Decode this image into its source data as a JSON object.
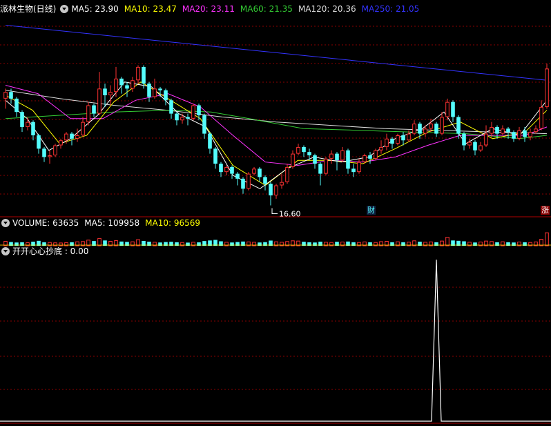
{
  "stock": {
    "name": "派林生物(日线)",
    "ma": [
      {
        "label": "MA5: 23.90",
        "color": "#ffffff"
      },
      {
        "label": "MA10: 23.47",
        "color": "#ffff00"
      },
      {
        "label": "MA20: 23.11",
        "color": "#ff33ff"
      },
      {
        "label": "MA60: 21.35",
        "color": "#33cc33"
      },
      {
        "label": "MA120: 20.36",
        "color": "#dddddd"
      },
      {
        "label": "MA250: 21.05",
        "color": "#3333ff"
      }
    ],
    "low_label": "16.60",
    "badge_cai": "财",
    "badge_zhang": "涨"
  },
  "volume": {
    "label": "VOLUME: 63635",
    "ma5": "MA5: 109958",
    "ma10": "MA10: 96569"
  },
  "indicator": {
    "label": "开开心心抄底 : 0.00"
  },
  "colors": {
    "up": "#ff3232",
    "down": "#54fcfc",
    "grid": "#8b0000",
    "ma5": "#ffffff",
    "ma10": "#ffff00",
    "ma20": "#ff33ff",
    "ma60": "#33cc33",
    "ma120": "#dddddd",
    "ma250": "#3333ff"
  },
  "chart_data": {
    "type": "candlestick",
    "price_range": [
      16.0,
      28.0
    ],
    "candles": [
      [
        23.0,
        23.4,
        22.4,
        23.6
      ],
      [
        23.4,
        23.0,
        22.7,
        23.6
      ],
      [
        23.0,
        22.2,
        21.9,
        23.1
      ],
      [
        22.2,
        21.3,
        21.0,
        22.3
      ],
      [
        21.3,
        21.6,
        21.1,
        21.9
      ],
      [
        21.6,
        20.8,
        20.5,
        21.7
      ],
      [
        20.8,
        20.0,
        19.7,
        20.9
      ],
      [
        20.0,
        19.5,
        19.2,
        20.1
      ],
      [
        19.5,
        19.6,
        19.1,
        19.9
      ],
      [
        19.6,
        20.2,
        19.5,
        20.3
      ],
      [
        20.2,
        20.5,
        20.0,
        20.6
      ],
      [
        20.5,
        20.9,
        20.3,
        21.0
      ],
      [
        20.9,
        20.6,
        20.2,
        21.0
      ],
      [
        20.6,
        20.8,
        20.4,
        21.2
      ],
      [
        20.8,
        21.6,
        20.7,
        21.9
      ],
      [
        21.6,
        22.6,
        21.4,
        22.8
      ],
      [
        22.6,
        22.1,
        21.9,
        22.7
      ],
      [
        22.1,
        23.6,
        22.0,
        24.6
      ],
      [
        23.6,
        23.2,
        22.5,
        23.9
      ],
      [
        23.2,
        23.4,
        22.6,
        23.8
      ],
      [
        23.4,
        24.2,
        23.1,
        24.9
      ],
      [
        24.2,
        23.8,
        23.3,
        24.3
      ],
      [
        23.8,
        23.6,
        23.1,
        24.0
      ],
      [
        23.6,
        24.1,
        23.4,
        24.3
      ],
      [
        24.1,
        24.9,
        23.9,
        25.0
      ],
      [
        24.9,
        23.9,
        23.6,
        25.0
      ],
      [
        23.9,
        23.1,
        22.8,
        24.0
      ],
      [
        23.1,
        23.6,
        23.0,
        24.2
      ],
      [
        23.6,
        23.5,
        23.1,
        23.7
      ],
      [
        23.5,
        22.9,
        22.6,
        23.6
      ],
      [
        22.9,
        22.1,
        21.8,
        23.0
      ],
      [
        22.1,
        21.7,
        21.4,
        22.2
      ],
      [
        21.7,
        21.9,
        21.5,
        22.1
      ],
      [
        21.9,
        21.8,
        21.4,
        22.1
      ],
      [
        21.8,
        22.6,
        21.7,
        22.7
      ],
      [
        22.6,
        22.0,
        21.7,
        22.7
      ],
      [
        22.0,
        20.9,
        20.6,
        22.1
      ],
      [
        20.9,
        20.0,
        19.7,
        21.0
      ],
      [
        20.0,
        19.1,
        18.8,
        20.1
      ],
      [
        19.1,
        18.6,
        18.3,
        19.2
      ],
      [
        18.6,
        18.9,
        18.4,
        19.0
      ],
      [
        18.9,
        18.5,
        18.2,
        19.0
      ],
      [
        18.5,
        18.2,
        17.8,
        18.6
      ],
      [
        18.2,
        17.6,
        17.3,
        18.3
      ],
      [
        17.6,
        18.5,
        17.5,
        18.6
      ],
      [
        18.5,
        18.8,
        18.4,
        18.9
      ],
      [
        18.8,
        18.3,
        18.0,
        18.9
      ],
      [
        18.3,
        17.9,
        17.5,
        18.4
      ],
      [
        17.9,
        17.2,
        16.6,
        18.0
      ],
      [
        17.2,
        17.8,
        17.0,
        17.9
      ],
      [
        17.8,
        18.0,
        17.6,
        18.5
      ],
      [
        18.0,
        18.9,
        17.9,
        19.1
      ],
      [
        18.9,
        19.7,
        18.8,
        19.9
      ],
      [
        19.7,
        20.1,
        19.6,
        20.3
      ],
      [
        20.1,
        19.8,
        19.5,
        20.2
      ],
      [
        19.8,
        19.6,
        19.3,
        20.0
      ],
      [
        19.6,
        19.1,
        18.8,
        19.7
      ],
      [
        19.1,
        18.5,
        17.8,
        19.2
      ],
      [
        18.5,
        19.4,
        18.4,
        19.5
      ],
      [
        19.4,
        19.7,
        19.1,
        19.9
      ],
      [
        19.7,
        19.3,
        18.7,
        19.8
      ],
      [
        19.3,
        19.9,
        19.2,
        20.1
      ],
      [
        19.9,
        18.8,
        18.5,
        20.0
      ],
      [
        18.8,
        18.6,
        18.3,
        19.1
      ],
      [
        18.6,
        19.2,
        18.5,
        19.4
      ],
      [
        19.2,
        19.6,
        19.1,
        19.7
      ],
      [
        19.6,
        19.4,
        19.1,
        19.8
      ],
      [
        19.4,
        19.9,
        19.3,
        20.0
      ],
      [
        19.9,
        20.1,
        19.7,
        20.5
      ],
      [
        20.1,
        20.6,
        19.9,
        20.9
      ],
      [
        20.6,
        20.3,
        20.0,
        20.7
      ],
      [
        20.3,
        20.8,
        20.2,
        20.9
      ],
      [
        20.8,
        20.5,
        20.2,
        21.0
      ],
      [
        20.5,
        20.9,
        20.4,
        21.1
      ],
      [
        20.9,
        21.5,
        20.8,
        21.7
      ],
      [
        21.5,
        20.9,
        20.6,
        21.6
      ],
      [
        20.9,
        21.2,
        20.7,
        21.4
      ],
      [
        21.2,
        21.5,
        21.0,
        21.8
      ],
      [
        21.5,
        20.9,
        20.7,
        21.6
      ],
      [
        20.9,
        21.9,
        20.8,
        22.2
      ],
      [
        21.9,
        22.8,
        21.7,
        23.0
      ],
      [
        22.8,
        21.9,
        21.6,
        22.9
      ],
      [
        21.9,
        20.9,
        20.6,
        22.0
      ],
      [
        20.9,
        20.2,
        19.9,
        21.0
      ],
      [
        20.2,
        20.4,
        20.0,
        20.6
      ],
      [
        20.4,
        19.9,
        19.6,
        20.5
      ],
      [
        19.9,
        20.2,
        19.8,
        20.4
      ],
      [
        20.2,
        20.9,
        20.1,
        21.4
      ],
      [
        20.9,
        21.3,
        20.7,
        21.6
      ],
      [
        21.3,
        20.9,
        20.6,
        21.4
      ],
      [
        20.9,
        21.2,
        20.8,
        21.4
      ],
      [
        21.2,
        21.0,
        20.6,
        21.3
      ],
      [
        21.0,
        20.6,
        20.4,
        21.1
      ],
      [
        20.6,
        21.1,
        20.5,
        21.3
      ],
      [
        21.1,
        20.7,
        20.4,
        21.3
      ],
      [
        20.7,
        21.0,
        20.5,
        21.2
      ],
      [
        21.0,
        21.2,
        20.9,
        21.4
      ],
      [
        21.2,
        22.5,
        21.1,
        22.9
      ],
      [
        22.5,
        24.8,
        22.4,
        25.1
      ]
    ],
    "low_marker_index": 48,
    "ma_series": {
      "ma250": [
        [
          0,
          27.4
        ],
        [
          100,
          24.1
        ]
      ],
      "ma120": [
        [
          0,
          23.5
        ],
        [
          10,
          23.0
        ],
        [
          20,
          22.6
        ],
        [
          30,
          22.3
        ],
        [
          40,
          21.9
        ],
        [
          50,
          21.6
        ],
        [
          60,
          21.4
        ],
        [
          70,
          21.2
        ],
        [
          80,
          21.1
        ],
        [
          90,
          21.0
        ],
        [
          100,
          20.9
        ]
      ],
      "ma60": [
        [
          0,
          21.8
        ],
        [
          10,
          22.0
        ],
        [
          20,
          22.2
        ],
        [
          30,
          22.3
        ],
        [
          38,
          22.2
        ],
        [
          45,
          21.8
        ],
        [
          55,
          21.2
        ],
        [
          65,
          21.1
        ],
        [
          75,
          21.0
        ],
        [
          85,
          20.9
        ],
        [
          95,
          20.6
        ],
        [
          100,
          20.8
        ]
      ],
      "ma20": [
        [
          0,
          23.8
        ],
        [
          6,
          23.3
        ],
        [
          12,
          21.8
        ],
        [
          18,
          21.8
        ],
        [
          24,
          22.9
        ],
        [
          30,
          23.3
        ],
        [
          36,
          22.5
        ],
        [
          42,
          20.8
        ],
        [
          48,
          19.2
        ],
        [
          54,
          19.0
        ],
        [
          60,
          19.3
        ],
        [
          66,
          19.2
        ],
        [
          72,
          19.5
        ],
        [
          78,
          20.2
        ],
        [
          84,
          20.8
        ],
        [
          90,
          20.8
        ],
        [
          96,
          20.8
        ],
        [
          100,
          21.3
        ]
      ],
      "ma10": [
        [
          0,
          23.2
        ],
        [
          5,
          22.3
        ],
        [
          10,
          20.3
        ],
        [
          15,
          20.8
        ],
        [
          20,
          22.8
        ],
        [
          25,
          24.0
        ],
        [
          30,
          23.0
        ],
        [
          36,
          21.8
        ],
        [
          42,
          19.0
        ],
        [
          48,
          17.8
        ],
        [
          54,
          19.3
        ],
        [
          60,
          19.3
        ],
        [
          66,
          19.1
        ],
        [
          72,
          20.0
        ],
        [
          78,
          21.0
        ],
        [
          84,
          21.6
        ],
        [
          90,
          20.6
        ],
        [
          96,
          21.0
        ],
        [
          100,
          22.3
        ]
      ],
      "ma5": [
        [
          0,
          22.9
        ],
        [
          4,
          21.8
        ],
        [
          8,
          19.9
        ],
        [
          12,
          20.6
        ],
        [
          17,
          22.0
        ],
        [
          22,
          24.0
        ],
        [
          27,
          23.7
        ],
        [
          32,
          22.1
        ],
        [
          37,
          21.3
        ],
        [
          42,
          18.4
        ],
        [
          47,
          17.6
        ],
        [
          52,
          18.8
        ],
        [
          57,
          19.5
        ],
        [
          62,
          19.2
        ],
        [
          67,
          19.5
        ],
        [
          72,
          20.6
        ],
        [
          77,
          21.2
        ],
        [
          81,
          22.2
        ],
        [
          85,
          20.3
        ],
        [
          90,
          21.2
        ],
        [
          95,
          20.8
        ],
        [
          100,
          22.9
        ]
      ]
    },
    "volume": {
      "max": 140000,
      "values": [
        38,
        32,
        28,
        30,
        26,
        35,
        42,
        30,
        28,
        25,
        24,
        27,
        30,
        34,
        36,
        48,
        40,
        62,
        45,
        38,
        44,
        36,
        33,
        34,
        52,
        41,
        35,
        30,
        28,
        32,
        34,
        30,
        28,
        27,
        30,
        29,
        40,
        45,
        50,
        38,
        30,
        28,
        32,
        36,
        33,
        30,
        28,
        31,
        44,
        34,
        30,
        36,
        42,
        40,
        34,
        30,
        28,
        35,
        30,
        28,
        34,
        32,
        36,
        30,
        28,
        33,
        30,
        28,
        35,
        38,
        30,
        34,
        30,
        31,
        42,
        35,
        30,
        33,
        30,
        40,
        72,
        45,
        42,
        38,
        30,
        28,
        32,
        40,
        36,
        30,
        34,
        30,
        28,
        32,
        30,
        28,
        33,
        55,
        110
      ]
    },
    "indicator": {
      "range": [
        0,
        1
      ],
      "spike_index": 78,
      "spike_value": 1
    }
  }
}
